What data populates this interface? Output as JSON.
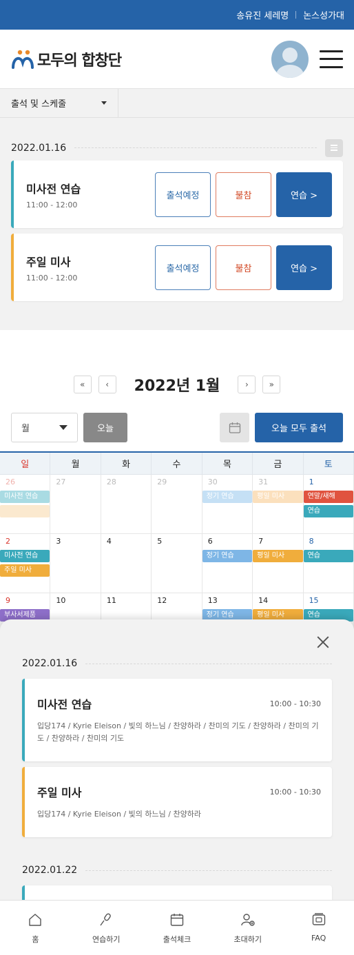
{
  "topbar": {
    "user_name": "송유진 세레명",
    "parish": "논스성가대"
  },
  "header": {
    "logo_text": "모두의 합창단"
  },
  "subnav": {
    "menu_label": "출석 및 스케줄"
  },
  "today": {
    "date": "2022.01.16",
    "schedules": [
      {
        "title": "미사전 연습",
        "time": "11:00 - 12:00",
        "color": "#3aa9bb",
        "attend_label": "출석예정",
        "absent_label": "불참",
        "practice_label": "연습 >"
      },
      {
        "title": "주일 미사",
        "time": "11:00 - 12:00",
        "color": "#f0ad3c",
        "attend_label": "출석예정",
        "absent_label": "불참",
        "practice_label": "연습 >"
      }
    ]
  },
  "calendar": {
    "month_title": "2022년 1월",
    "view_mode": "월",
    "today_label": "오늘",
    "attend_all_label": "오늘 모두 출석",
    "weekdays": [
      "일",
      "월",
      "화",
      "수",
      "목",
      "금",
      "토"
    ],
    "weeks": [
      [
        {
          "day": "26",
          "dim": true,
          "events": [
            {
              "label": "미사전 연습",
              "color": "#a9dbe3"
            },
            {
              "label": "",
              "color": "#fbe9cf"
            }
          ]
        },
        {
          "day": "27",
          "dim": true,
          "events": []
        },
        {
          "day": "28",
          "dim": true,
          "events": []
        },
        {
          "day": "29",
          "dim": true,
          "events": []
        },
        {
          "day": "30",
          "dim": true,
          "events": [
            {
              "label": "정기 연습",
              "color": "#c5e0f5"
            }
          ]
        },
        {
          "day": "31",
          "dim": true,
          "events": [
            {
              "label": "평일 미사",
              "color": "#fbe0bd"
            }
          ]
        },
        {
          "day": "1",
          "dim": false,
          "events": [
            {
              "label": "연말/새해",
              "color": "#e0533f"
            },
            {
              "label": "연습",
              "color": "#3aa9bb"
            }
          ]
        }
      ],
      [
        {
          "day": "2",
          "dim": false,
          "events": [
            {
              "label": "미사전 연습",
              "color": "#3aa9bb"
            },
            {
              "label": "주일 미사",
              "color": "#f0ad3c"
            }
          ]
        },
        {
          "day": "3",
          "dim": false,
          "events": []
        },
        {
          "day": "4",
          "dim": false,
          "events": []
        },
        {
          "day": "5",
          "dim": false,
          "events": []
        },
        {
          "day": "6",
          "dim": false,
          "events": [
            {
              "label": "정기 연습",
              "color": "#7eb6e6"
            }
          ]
        },
        {
          "day": "7",
          "dim": false,
          "events": [
            {
              "label": "평일 미사",
              "color": "#f0ad3c"
            }
          ]
        },
        {
          "day": "8",
          "dim": false,
          "events": [
            {
              "label": "연습",
              "color": "#3aa9bb"
            }
          ]
        }
      ],
      [
        {
          "day": "9",
          "dim": false,
          "events": [
            {
              "label": "부사서제품",
              "color": "#8e6fc9"
            }
          ]
        },
        {
          "day": "10",
          "dim": false,
          "events": []
        },
        {
          "day": "11",
          "dim": false,
          "events": []
        },
        {
          "day": "12",
          "dim": false,
          "events": []
        },
        {
          "day": "13",
          "dim": false,
          "events": [
            {
              "label": "정기 연습",
              "color": "#7eb6e6"
            }
          ]
        },
        {
          "day": "14",
          "dim": false,
          "events": [
            {
              "label": "평일 미사",
              "color": "#f0ad3c"
            }
          ]
        },
        {
          "day": "15",
          "dim": false,
          "events": [
            {
              "label": "연습",
              "color": "#3aa9bb"
            }
          ]
        }
      ]
    ]
  },
  "sheet": {
    "groups": [
      {
        "date": "2022.01.16",
        "items": [
          {
            "title": "미사전 연습",
            "time": "10:00 - 10:30",
            "songs": "입당174 / Kyrie Eleison / 빛의 하느님 / 찬양하라 / 찬미의 기도 / 찬양하라 / 찬미의 기도 / 찬양하라 / 찬미의 기도",
            "color": "#3aa9bb"
          },
          {
            "title": "주일 미사",
            "time": "10:00 - 10:30",
            "songs": "입당174 / Kyrie Eleison / 빛의 하느님 / 찬양하라",
            "color": "#f0ad3c"
          }
        ]
      },
      {
        "date": "2022.01.22",
        "items": [
          {
            "color": "#3aa9bb"
          }
        ]
      }
    ]
  },
  "bottom_nav": [
    {
      "label": "홈",
      "icon": "home-icon"
    },
    {
      "label": "연습하기",
      "icon": "microphone-icon"
    },
    {
      "label": "출석체크",
      "icon": "calendar-icon"
    },
    {
      "label": "초대하기",
      "icon": "invite-user-icon"
    },
    {
      "label": "FAQ",
      "icon": "faq-icon"
    }
  ]
}
